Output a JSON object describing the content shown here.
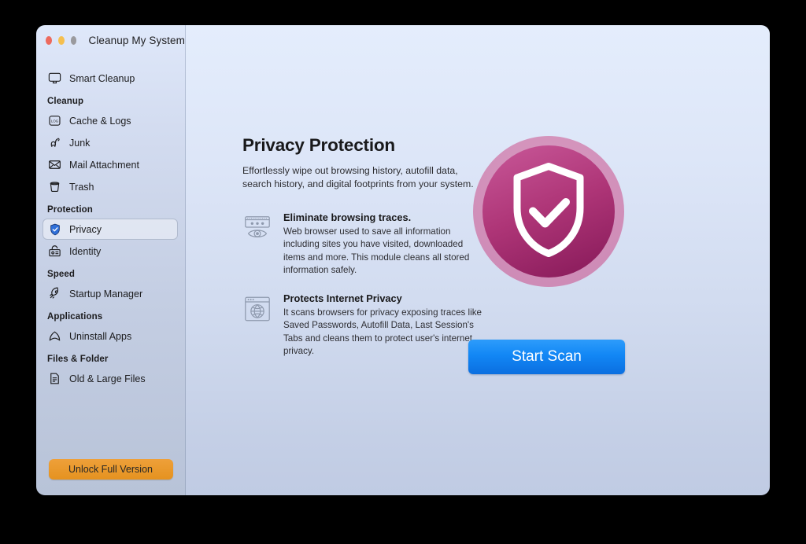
{
  "window": {
    "title": "Cleanup My System",
    "traffic_lights": [
      {
        "name": "close",
        "color": "#ed6a5e"
      },
      {
        "name": "minimize",
        "color": "#f5bf4f"
      },
      {
        "name": "zoom",
        "color": "#9a9a9e"
      }
    ]
  },
  "sidebar": {
    "top_item": {
      "label": "Smart Cleanup",
      "icon": "monitor-icon"
    },
    "groups": [
      {
        "label": "Cleanup",
        "items": [
          {
            "label": "Cache & Logs",
            "icon": "log-file-icon",
            "selected": false
          },
          {
            "label": "Junk",
            "icon": "vacuum-icon",
            "selected": false
          },
          {
            "label": "Mail Attachment",
            "icon": "envelope-icon",
            "selected": false
          },
          {
            "label": "Trash",
            "icon": "trash-icon",
            "selected": false
          }
        ]
      },
      {
        "label": "Protection",
        "items": [
          {
            "label": "Privacy",
            "icon": "shield-check-icon",
            "selected": true
          },
          {
            "label": "Identity",
            "icon": "id-card-lock-icon",
            "selected": false
          }
        ]
      },
      {
        "label": "Speed",
        "items": [
          {
            "label": "Startup Manager",
            "icon": "rocket-icon",
            "selected": false
          }
        ]
      },
      {
        "label": "Applications",
        "items": [
          {
            "label": "Uninstall Apps",
            "icon": "uninstall-arch-icon",
            "selected": false
          }
        ]
      },
      {
        "label": "Files & Folder",
        "items": [
          {
            "label": "Old & Large Files",
            "icon": "document-lines-icon",
            "selected": false
          }
        ]
      }
    ],
    "unlock_button": {
      "label": "Unlock Full Version",
      "color": "#e5921f"
    }
  },
  "main": {
    "title": "Privacy Protection",
    "subtitle": "Effortlessly wipe out browsing history, autofill data, search history, and digital footprints from your system.",
    "features": [
      {
        "icon": "browser-eye-icon",
        "title": "Eliminate browsing traces.",
        "description": "Web browser used to save all information including sites you have visited, downloaded items and more. This module cleans all stored information safely."
      },
      {
        "icon": "browser-globe-icon",
        "title": "Protects Internet Privacy",
        "description": "It scans browsers for privacy exposing traces like Saved Passwords, Autofill Data, Last Session's Tabs and cleans them to protect user's internet privacy."
      }
    ],
    "hero_icon": "shield-check-badge-icon",
    "hero_colors": {
      "ring": "#d78bb4",
      "gradient_start": "#c4518f",
      "gradient_end": "#8e1f60"
    },
    "scan_button": {
      "label": "Start Scan",
      "color": "#1287f5"
    }
  }
}
